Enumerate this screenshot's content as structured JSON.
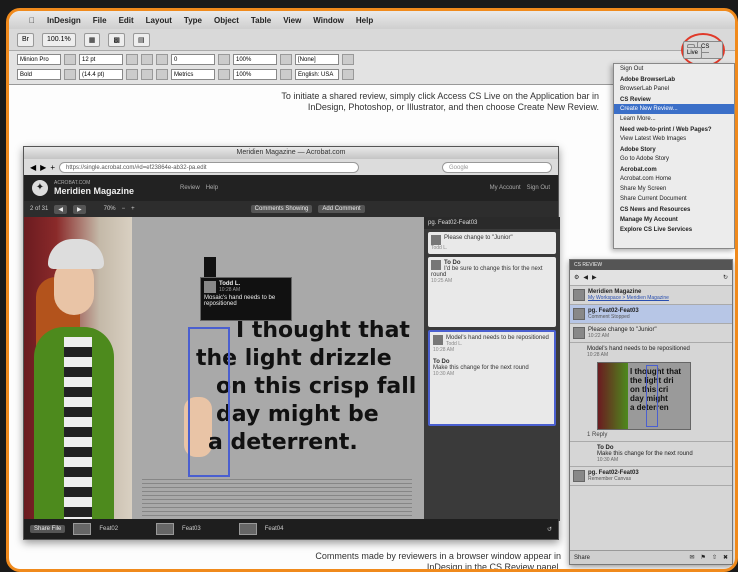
{
  "indesign": {
    "menu": [
      "InDesign",
      "File",
      "Edit",
      "Layout",
      "Type",
      "Object",
      "Table",
      "View",
      "Window",
      "Help"
    ],
    "zoom": "100.1%",
    "font_name": "Minion Pro",
    "font_style": "Bold",
    "cs_live_label": "CS Live"
  },
  "cs_live_menu": {
    "items": [
      {
        "label": "Sign Out",
        "type": "item"
      },
      {
        "label": "Adobe BrowserLab",
        "type": "head"
      },
      {
        "label": "BrowserLab Panel",
        "type": "item"
      },
      {
        "label": "CS Review",
        "type": "head"
      },
      {
        "label": "Create New Review...",
        "type": "selected"
      },
      {
        "label": "Learn More...",
        "type": "item"
      },
      {
        "label": "Need web-to-print / Web Pages?",
        "type": "head"
      },
      {
        "label": "View Latest Web Images",
        "type": "item"
      },
      {
        "label": "Adobe Story",
        "type": "head"
      },
      {
        "label": "Go to Adobe Story",
        "type": "item"
      },
      {
        "label": "Acrobat.com",
        "type": "head"
      },
      {
        "label": "Acrobat.com Home",
        "type": "item"
      },
      {
        "label": "Share My Screen",
        "type": "item"
      },
      {
        "label": "Share Current Document",
        "type": "item"
      },
      {
        "label": "CS News and Resources",
        "type": "head"
      },
      {
        "label": "Manage My Account",
        "type": "head"
      },
      {
        "label": "Explore CS Live Services",
        "type": "head"
      }
    ]
  },
  "captions": {
    "top": "To initiate a shared review, simply click Access CS Live on the Application bar in InDesign, Photoshop, or Illustrator, and then choose Create New Review.",
    "bottom": "Comments made by reviewers in a browser window appear in InDesign in the CS Review panel."
  },
  "browser": {
    "title": "Meridien Magazine — Acrobat.com",
    "url": "https://single.acrobat.com/#d=ef23864e-ab32-pa.edit",
    "search_placeholder": "Google",
    "site_name": "ACROBAT.COM",
    "publication": "Meridien Magazine",
    "nav_links": [
      "Review",
      "Help"
    ],
    "account_links": [
      "My Account",
      "Sign Out"
    ],
    "page_indicator": "2 of 31",
    "zoom": "70%",
    "comments_filter": "Comments Showing",
    "add_comment": "Add Comment",
    "panel_header": "pg. Feat02-Feat03",
    "quote_lines": [
      "I thought that",
      "the light drizzle",
      "on this crisp fall",
      "day might be",
      "a deterrent."
    ],
    "popup": {
      "author": "Todd L.",
      "time": "10:28 AM",
      "text": "Mosaic's hand needs to be repositioned"
    },
    "comments": [
      {
        "author": "Todd L.",
        "text": "Please change to \"Junior\"",
        "time": "10:22 AM"
      },
      {
        "author": "To Do",
        "text": "I'd be sure to change this for the next round",
        "time": "10:25 AM"
      },
      {
        "author": "Todd L.",
        "text": "Model's hand needs to be repositioned",
        "time": "10:28 AM"
      },
      {
        "author": "To Do",
        "text": "Make this change for the next round",
        "time": "10:30 AM"
      }
    ],
    "footer_btn": "Share File",
    "footer_thumbs": [
      "Feat02",
      "Feat03",
      "Feat04"
    ]
  },
  "cs_review_panel": {
    "title": "CS REVIEW",
    "review_name": "Meridien Magazine",
    "review_link": "My Workspace > Meridien Magazine",
    "page_row": "pg. Feat02-Feat03",
    "page_status": "Comment Stopped",
    "comment1": "Please change to \"Junior\"",
    "comment1_time": "10:22 AM",
    "comment2": "Model's hand needs to be repositioned",
    "comment2_time": "10:28 AM",
    "replies": "1 Reply",
    "todo_title": "To Do",
    "todo_text": "Make this change for the next round",
    "todo_time": "10:30 AM",
    "footer_row": "pg. Feat02-Feat03",
    "footer_sub": "Remember Canvas",
    "share_label": "Share",
    "mini_lines": [
      "I thought that",
      "the light dri",
      "on this cri",
      "day might",
      "a deterren"
    ]
  }
}
